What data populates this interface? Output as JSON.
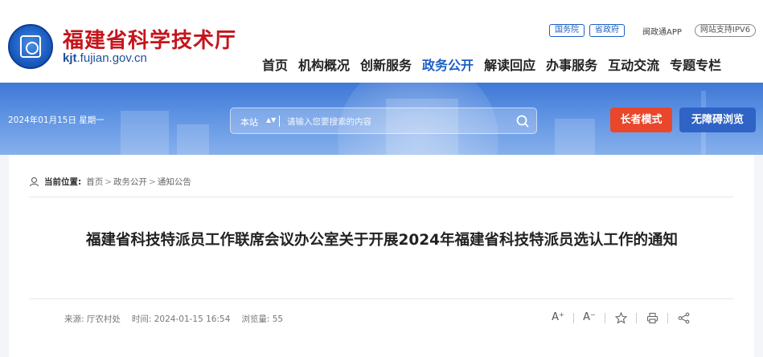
{
  "header": {
    "site_title": "福建省科学技术厅",
    "site_domain_bold": "kjt",
    "site_domain_rest": ".fujian.gov.cn",
    "top_links": {
      "state_council": "国务院",
      "provincial_gov": "省政府",
      "app": "闽政通APP",
      "ipv6": "网站支持IPV6"
    },
    "nav": [
      "首页",
      "机构概况",
      "创新服务",
      "政务公开",
      "解读回应",
      "办事服务",
      "互动交流",
      "专题专栏"
    ],
    "active_nav": "政务公开",
    "colors": {
      "brand_red": "#c6141c",
      "brand_blue": "#1d5fc4"
    }
  },
  "banner": {
    "date": "2024年01月15日 星期一",
    "search": {
      "scope": "本站",
      "placeholder": "请输入您要搜索的内容"
    },
    "elder_mode": "长者模式",
    "accessibility": "无障碍浏览",
    "colors": {
      "elder": "#e8472b",
      "accessible": "#2f63c5"
    }
  },
  "breadcrumb": {
    "label": "当前位置:",
    "items": [
      "首页",
      "政务公开",
      "通知公告"
    ]
  },
  "article": {
    "title": "福建省科技特派员工作联席会议办公室关于开展2024年福建省科技特派员选认工作的通知",
    "meta": {
      "source": "来源: 厅农村处",
      "time": "时间: 2024-01-15 16:54",
      "views": "浏览量: 55"
    },
    "tools": {
      "font_larger": "A⁺",
      "font_smaller": "A⁻"
    }
  }
}
